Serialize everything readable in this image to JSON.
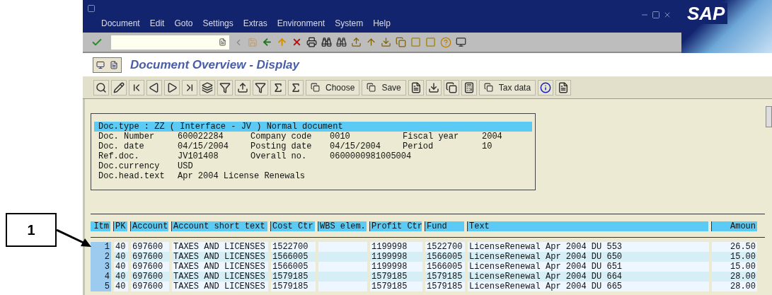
{
  "menu": [
    "Document",
    "Edit",
    "Goto",
    "Settings",
    "Extras",
    "Environment",
    "System",
    "Help"
  ],
  "logo": "SAP",
  "title": "Document Overview - Display",
  "app_toolbar": [
    {
      "kind": "icon"
    },
    {
      "kind": "icon"
    },
    {
      "kind": "icon"
    },
    {
      "kind": "icon"
    },
    {
      "kind": "icon"
    },
    {
      "kind": "icon"
    },
    {
      "kind": "icon"
    },
    {
      "kind": "icon"
    },
    {
      "kind": "icon"
    },
    {
      "kind": "icon"
    },
    {
      "kind": "icon"
    },
    {
      "kind": "icon"
    },
    {
      "kind": "text",
      "label": "Choose"
    },
    {
      "kind": "text",
      "label": "Save"
    },
    {
      "kind": "icon"
    },
    {
      "kind": "icon"
    },
    {
      "kind": "icon"
    },
    {
      "kind": "icon"
    },
    {
      "kind": "text",
      "label": "Tax data"
    },
    {
      "kind": "icon"
    },
    {
      "kind": "icon"
    }
  ],
  "header": {
    "title_line": "Doc.type : ZZ ( Interface - JV ) Normal document",
    "rows": [
      [
        {
          "label": "Doc. Number",
          "value": "600022284"
        },
        {
          "label": "Company code",
          "value": "0010"
        },
        {
          "label": "Fiscal year",
          "value": "2004"
        }
      ],
      [
        {
          "label": "Doc. date",
          "value": "04/15/2004"
        },
        {
          "label": "Posting date",
          "value": "04/15/2004"
        },
        {
          "label": "Period",
          "value": "10"
        }
      ],
      [
        {
          "label": "Ref.doc.",
          "value": "JV101408"
        },
        {
          "label": "Overall no.",
          "value": "0600000981005004"
        }
      ],
      [
        {
          "label": "Doc.currency",
          "value": "USD"
        }
      ],
      [
        {
          "label": "Doc.head.text",
          "value": "Apr 2004 License Renewals"
        }
      ]
    ]
  },
  "table": {
    "columns": [
      "Itm",
      "PK",
      "Account",
      "Account short text",
      "Cost Ctr",
      "WBS elem.",
      "Profit Ctr",
      "Fund",
      "Text",
      "Amoun"
    ],
    "rows": [
      [
        "1",
        "40",
        "697600",
        "TAXES AND LICENSES",
        "1522700",
        "",
        "1199998",
        "1522700",
        "LicenseRenewal Apr 2004 DU 553",
        "26.50"
      ],
      [
        "2",
        "40",
        "697600",
        "TAXES AND LICENSES",
        "1566005",
        "",
        "1199998",
        "1566005",
        "LicenseRenewal Apr 2004 DU 650",
        "15.00"
      ],
      [
        "3",
        "40",
        "697600",
        "TAXES AND LICENSES",
        "1566005",
        "",
        "1199998",
        "1566005",
        "LicenseRenewal Apr 2004 DU 651",
        "15.00"
      ],
      [
        "4",
        "40",
        "697600",
        "TAXES AND LICENSES",
        "1579185",
        "",
        "1579185",
        "1579185",
        "LicenseRenewal Apr 2004 DU 664",
        "28.00"
      ],
      [
        "5",
        "40",
        "697600",
        "TAXES AND LICENSES",
        "1579185",
        "",
        "1579185",
        "1579185",
        "LicenseRenewal Apr 2004 DU 665",
        "28.00"
      ]
    ]
  },
  "callout": {
    "label": "1"
  }
}
